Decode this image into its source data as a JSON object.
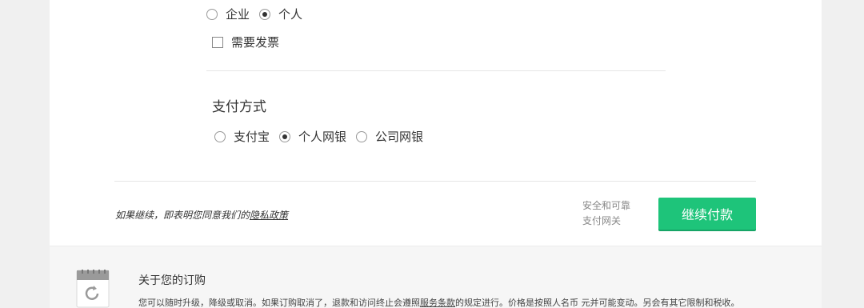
{
  "buyer_type": {
    "options": [
      {
        "label": "企业",
        "checked": false
      },
      {
        "label": "个人",
        "checked": true
      }
    ]
  },
  "invoice": {
    "label": "需要发票",
    "checked": false
  },
  "payment": {
    "title": "支付方式",
    "options": [
      {
        "label": "支付宝",
        "checked": false
      },
      {
        "label": "个人网银",
        "checked": true
      },
      {
        "label": "公司网银",
        "checked": false
      }
    ]
  },
  "agreement": {
    "prefix": "如果继续，即表明您同意我们的",
    "link": "隐私政策"
  },
  "secure_gateway": {
    "line1": "安全和可靠",
    "line2": "支付网关"
  },
  "continue_button": "继续付款",
  "about": {
    "title": "关于您的订购",
    "text_a": "您可以随时升级，降级或取消。如果订购取消了，退款和访问终止会遵照",
    "link": "服务条款",
    "text_b": "的规定进行。价格是按照人名币 元并可能变动。另会有其它限制和税收。"
  },
  "colors": {
    "accent": "#1ec47a"
  }
}
